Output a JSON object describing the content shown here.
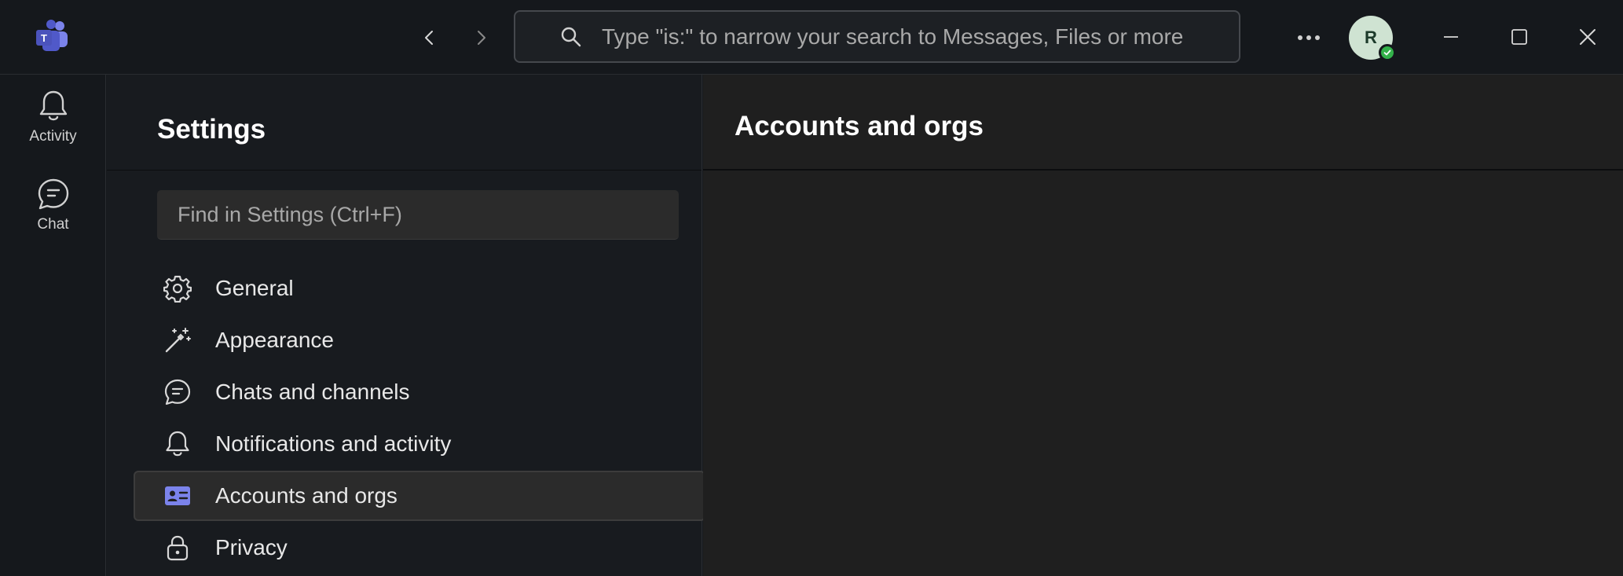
{
  "titlebar": {
    "search_placeholder": "Type \"is:\" to narrow your search to Messages, Files or more",
    "avatar_initial": "R"
  },
  "rail": {
    "items": [
      {
        "label": "Activity",
        "icon": "bell-icon"
      },
      {
        "label": "Chat",
        "icon": "chat-icon"
      }
    ]
  },
  "settings": {
    "title": "Settings",
    "find_placeholder": "Find in Settings (Ctrl+F)",
    "menu": [
      {
        "label": "General",
        "icon": "gear-icon"
      },
      {
        "label": "Appearance",
        "icon": "magic-wand-icon"
      },
      {
        "label": "Chats and channels",
        "icon": "chat-icon"
      },
      {
        "label": "Notifications and activity",
        "icon": "bell-icon"
      },
      {
        "label": "Accounts and orgs",
        "icon": "contact-card-icon",
        "active": true
      },
      {
        "label": "Privacy",
        "icon": "lock-icon"
      }
    ]
  },
  "content": {
    "title": "Accounts and orgs"
  },
  "colors": {
    "accent": "#7b83eb",
    "presence": "#33b24a",
    "avatar_bg": "#cfe3d2"
  }
}
